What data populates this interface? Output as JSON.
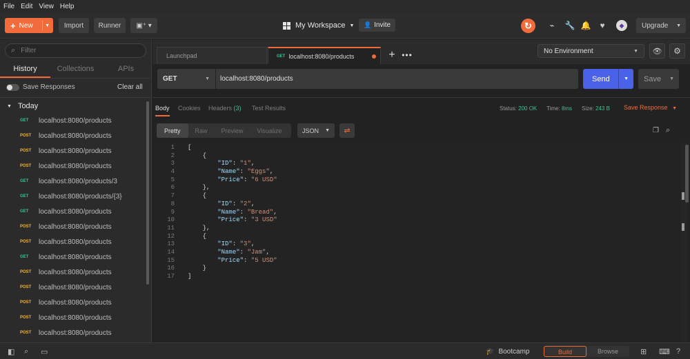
{
  "menu": [
    "File",
    "Edit",
    "View",
    "Help"
  ],
  "toolbar": {
    "new_label": "New",
    "import_label": "Import",
    "runner_label": "Runner",
    "workspace_label": "My Workspace",
    "invite_label": "Invite",
    "upgrade_label": "Upgrade"
  },
  "sidebar": {
    "filter_placeholder": "Filter",
    "tabs": [
      "History",
      "Collections",
      "APIs"
    ],
    "active_tab": "History",
    "save_responses_label": "Save Responses",
    "clear_all_label": "Clear all",
    "group_label": "Today",
    "history": [
      {
        "method": "GET",
        "url": "localhost:8080/products"
      },
      {
        "method": "POST",
        "url": "localhost:8080/products"
      },
      {
        "method": "POST",
        "url": "localhost:8080/products"
      },
      {
        "method": "POST",
        "url": "localhost:8080/products"
      },
      {
        "method": "GET",
        "url": "localhost:8080/products/3"
      },
      {
        "method": "GET",
        "url": "localhost:8080/products/{3}"
      },
      {
        "method": "GET",
        "url": "localhost:8080/products"
      },
      {
        "method": "POST",
        "url": "localhost:8080/products"
      },
      {
        "method": "POST",
        "url": "localhost:8080/products"
      },
      {
        "method": "GET",
        "url": "localhost:8080/products"
      },
      {
        "method": "POST",
        "url": "localhost:8080/products"
      },
      {
        "method": "POST",
        "url": "localhost:8080/products"
      },
      {
        "method": "POST",
        "url": "localhost:8080/products"
      },
      {
        "method": "POST",
        "url": "localhost:8080/products"
      },
      {
        "method": "POST",
        "url": "localhost:8080/products"
      },
      {
        "method": "POST",
        "url": "localhost:8080/products"
      },
      {
        "method": "POST",
        "url": "localhost:8080/products"
      }
    ]
  },
  "tabs": {
    "launchpad_label": "Launchpad",
    "active_method": "GET",
    "active_label": "localhost:8080/products"
  },
  "environment": {
    "selected": "No Environment"
  },
  "request": {
    "method": "GET",
    "url": "localhost:8080/products",
    "send_label": "Send",
    "save_label": "Save"
  },
  "response": {
    "tabs": {
      "body": "Body",
      "cookies": "Cookies",
      "headers": "Headers",
      "headers_count": "(3)",
      "tests": "Test Results"
    },
    "status_label": "Status:",
    "status_value": "200 OK",
    "time_label": "Time:",
    "time_value": "8ms",
    "size_label": "Size:",
    "size_value": "243 B",
    "save_response_label": "Save Response",
    "view_modes": [
      "Pretty",
      "Raw",
      "Preview",
      "Visualize"
    ],
    "active_view": "Pretty",
    "format": "JSON",
    "body_lines": [
      "[",
      "    {",
      "        \"ID\": \"1\",",
      "        \"Name\": \"Eggs\",",
      "        \"Price\": \"6 USD\"",
      "    },",
      "    {",
      "        \"ID\": \"2\",",
      "        \"Name\": \"Bread\",",
      "        \"Price\": \"3 USD\"",
      "    },",
      "    {",
      "        \"ID\": \"3\",",
      "        \"Name\": \"Jam\",",
      "        \"Price\": \"5 USD\"",
      "    }",
      "]"
    ]
  },
  "statusbar": {
    "bootcamp_label": "Bootcamp",
    "build_label": "Build",
    "browse_label": "Browse"
  },
  "colors": {
    "accent": "#f26b3a",
    "send": "#4a62e8",
    "get": "#3ec28f",
    "post": "#f0b33a"
  },
  "icons": [
    "filter-search-icon",
    "sync-icon",
    "satellite-icon",
    "wrench-icon",
    "bell-icon",
    "heart-icon",
    "user-badge-icon",
    "eye-icon",
    "gear-icon",
    "copy-icon",
    "search-icon",
    "wrap-icon",
    "sidebar-icon",
    "console-icon",
    "bootcamp-icon",
    "layout-icon",
    "help-icon"
  ]
}
